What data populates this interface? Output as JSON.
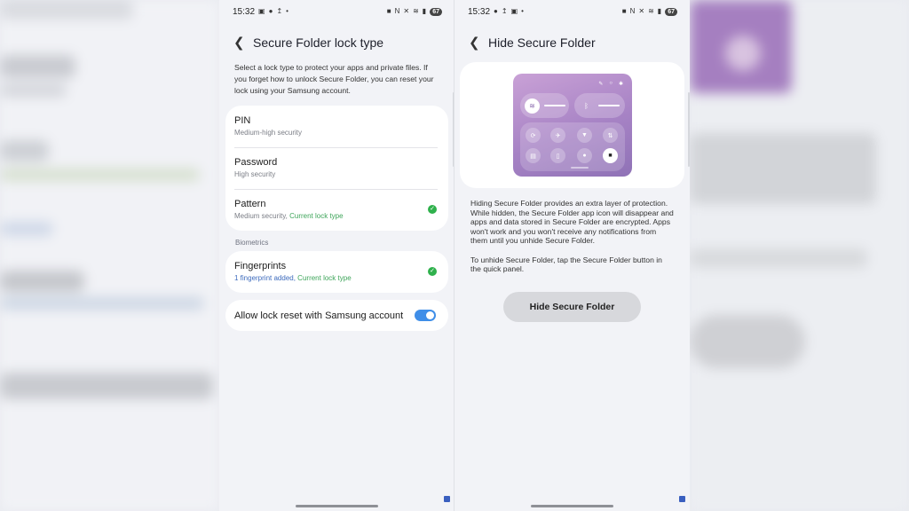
{
  "colors": {
    "accent_green": "#2fb14c",
    "toggle_blue": "#3f8ee8",
    "link_blue": "#3d6bbd",
    "panel_purple": "#a783c5"
  },
  "status_bar_left": {
    "time": "15:32",
    "icons": [
      "screenshot-icon",
      "location-icon",
      "upload-icon",
      "dot-icon"
    ]
  },
  "status_bar_right": {
    "time": "15:32",
    "icons": [
      "location-icon",
      "upload-icon",
      "screenshot-icon",
      "dot-icon"
    ]
  },
  "battery": "67",
  "lock_screen": {
    "title": "Secure Folder lock type",
    "description": "Select a lock type to protect your apps and private files. If you forget how to unlock Secure Folder, you can reset your lock using your Samsung account.",
    "options": [
      {
        "title": "PIN",
        "subtitle": "Medium-high security"
      },
      {
        "title": "Password",
        "subtitle": "High security"
      },
      {
        "title": "Pattern",
        "subtitle": "Medium security, ",
        "current": "Current lock type"
      }
    ],
    "biometrics_label": "Biometrics",
    "fingerprints": {
      "title": "Fingerprints",
      "subtitle": "1 fingerprint added, ",
      "current": "Current lock type"
    },
    "allow_reset": {
      "label": "Allow lock reset with Samsung account",
      "enabled": true
    }
  },
  "hide_screen": {
    "title": "Hide Secure Folder",
    "description_1": "Hiding Secure Folder provides an extra layer of protection. While hidden, the Secure Folder app icon will disappear and apps and data stored in Secure Folder are encrypted. Apps won't work and you won't receive any notifications from them until you unhide Secure Folder.",
    "description_2": "To unhide Secure Folder, tap the Secure Folder button in the quick panel.",
    "button": "Hide Secure Folder"
  }
}
